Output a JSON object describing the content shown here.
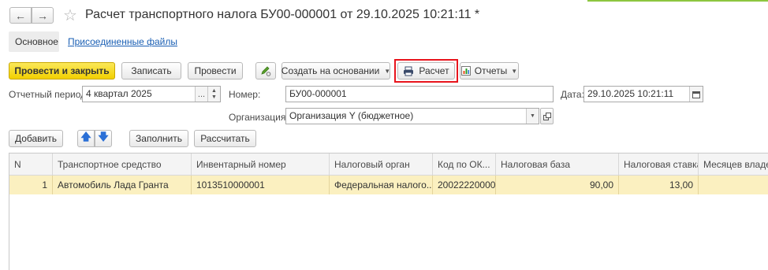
{
  "window": {
    "title": "Расчет транспортного налога БУ00-000001 от 29.10.2025 10:21:11 *",
    "nav_back_icon": "arrow-left-icon",
    "nav_forward_icon": "arrow-right-icon",
    "favorite_icon": "star-icon"
  },
  "tabs": [
    {
      "label": "Основное"
    },
    {
      "label": "Присоединенные файлы"
    }
  ],
  "toolbar": {
    "post_close": "Провести и закрыть",
    "save": "Записать",
    "post": "Провести",
    "create_based": "Создать на основании",
    "calc": "Расчет",
    "reports": "Отчеты"
  },
  "form": {
    "period_label": "Отчетный период:",
    "period_value": "4 квартал 2025",
    "period_btn": "...",
    "number_label": "Номер:",
    "number_value": "БУ00-000001",
    "date_label": "Дата:",
    "date_value": "29.10.2025 10:21:11",
    "org_label": "Организация:",
    "org_value": "Организация Y (бюджетное)"
  },
  "table_toolbar": {
    "add": "Добавить",
    "fill": "Заполнить",
    "recalc": "Рассчитать"
  },
  "table": {
    "columns": [
      "N",
      "Транспортное средство",
      "Инвентарный номер",
      "Налоговый орган",
      "Код по ОК...",
      "Налоговая база",
      "Налоговая ставка",
      "Месяцев владен"
    ],
    "rows": [
      [
        "1",
        "Автомобиль Лада Гранта",
        "1013510000001",
        "Федеральная налого...",
        "20022220000",
        "90,00",
        "13,00",
        ""
      ]
    ]
  },
  "colors": {
    "accent_yellow": "#f2d000",
    "highlight_red": "#e8141c",
    "row_selected": "#fbf0c0",
    "link_blue": "#1a5fb4"
  }
}
